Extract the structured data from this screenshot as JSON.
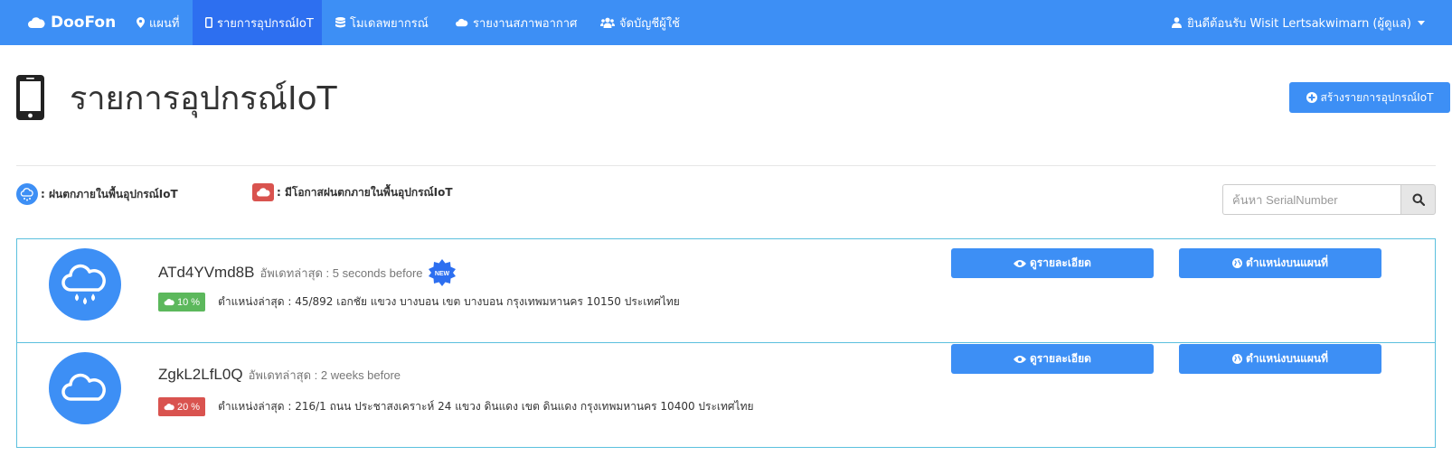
{
  "navbar": {
    "brand": "DooFon",
    "items": [
      {
        "label": "แผนที่",
        "icon": "map-marker-icon"
      },
      {
        "label": "รายการอุปกรณ์IoT",
        "icon": "mobile-icon",
        "active": true
      },
      {
        "label": "โมเดลพยากรณ์",
        "icon": "database-icon"
      },
      {
        "label": "รายงานสภาพอากาศ",
        "icon": "cloud-icon"
      },
      {
        "label": "จัดบัญชีผู้ใช้",
        "icon": "users-icon"
      }
    ],
    "user": "ยินดีต้อนรับ Wisit Lertsakwimarn (ผู้ดูแล)"
  },
  "header": {
    "title": "รายการอุปกรณ์IoT",
    "create_button": "สร้างรายการอุปกรณ์IoT"
  },
  "legend": {
    "raining": ": ฝนตกภายในพื้นอุปกรณ์IoT",
    "chance": ": มีโอกาสฝนตกภายในพื้นอุปกรณ์IoT"
  },
  "search": {
    "placeholder": "ค้นหา SerialNumber",
    "value": ""
  },
  "devices": [
    {
      "serial": "ATd4YVmd8B",
      "updated": "อัพเดทล่าสุด : 5 seconds before",
      "new_badge": "NEW",
      "percent": "10 %",
      "location": "ตำแหน่งล่าสุด : 45/892 เอกชัย แขวง บางบอน เขต บางบอน กรุงเทพมหานคร 10150 ประเทศไทย",
      "status": "raining",
      "detail_button": "ดูรายละเอียด",
      "map_button": "ตำแหน่งบนแผนที่"
    },
    {
      "serial": "ZgkL2LfL0Q",
      "updated": "อัพเดทล่าสุด : 2 weeks before",
      "percent": "20 %",
      "location": "ตำแหน่งล่าสุด : 216/1 ถนน ประชาสงเคราะห์ 24 แขวง ดินแดง เขต ดินแดง กรุงเทพมหานคร 10400 ประเทศไทย",
      "status": "cloudy",
      "detail_button": "ดูรายละเอียด",
      "map_button": "ตำแหน่งบนแผนที่"
    }
  ],
  "colors": {
    "primary": "#3d8ff5",
    "nav_active": "#2d6ff0",
    "success": "#5cb85c",
    "danger": "#d9534f",
    "list_border": "#5bc0de"
  }
}
